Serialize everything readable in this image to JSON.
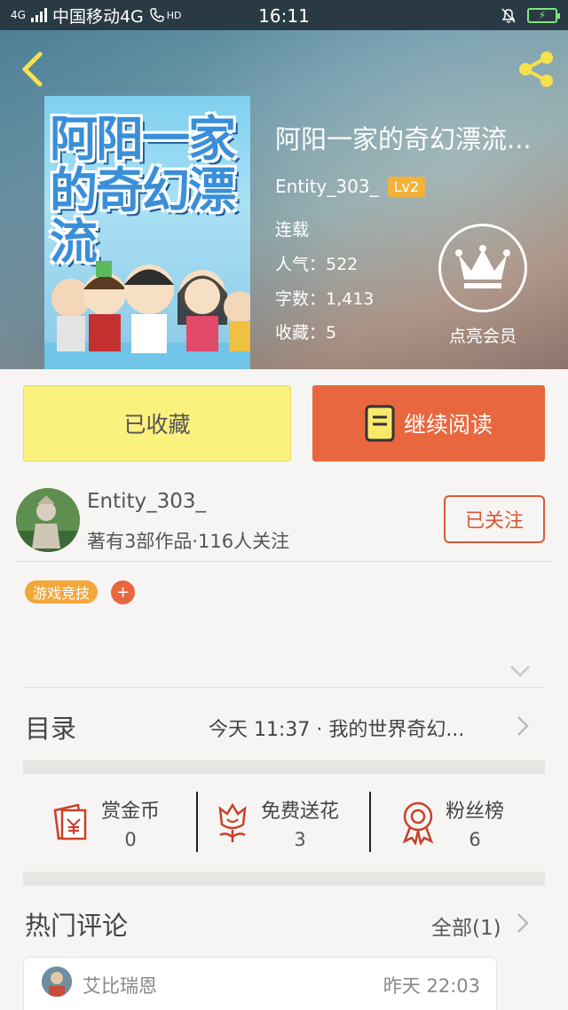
{
  "status_bar": {
    "network_small": "4G",
    "carrier": "中国移动4G",
    "hd": "HD",
    "time": "16:11"
  },
  "book": {
    "title": "阿阳一家的奇幻漂流...",
    "cover_text": "阿阳一家的奇幻漂流",
    "author": "Entity_303_",
    "level": "Lv2",
    "status": "连载",
    "popularity": "人气：522",
    "word_count": "字数：1,413",
    "favorites": "收藏：5"
  },
  "vip": {
    "label": "点亮会员"
  },
  "actions": {
    "favorite_label": "已收藏",
    "read_label": "继续阅读"
  },
  "author_card": {
    "name": "Entity_303_",
    "stats": "著有3部作品·116人关注",
    "follow_label": "已关注"
  },
  "tags": [
    {
      "label": "游戏竞技"
    }
  ],
  "tag_add": "+",
  "toc": {
    "title": "目录",
    "latest": "今天 11:37 · 我的世界奇幻..."
  },
  "stats": [
    {
      "label": "赏金币",
      "value": "0"
    },
    {
      "label": "免费送花",
      "value": "3"
    },
    {
      "label": "粉丝榜",
      "value": "6"
    }
  ],
  "comments": {
    "title": "热门评论",
    "all_label": "全部(1)",
    "items": [
      {
        "user": "艾比瑞恩",
        "time": "昨天 22:03"
      }
    ]
  },
  "colors": {
    "accent_orange": "#e8673e",
    "favorite_yellow": "#fbf17d",
    "tag_orange": "#f2a73a",
    "level_badge": "#f3b23a",
    "icon_red": "#c9402a"
  }
}
